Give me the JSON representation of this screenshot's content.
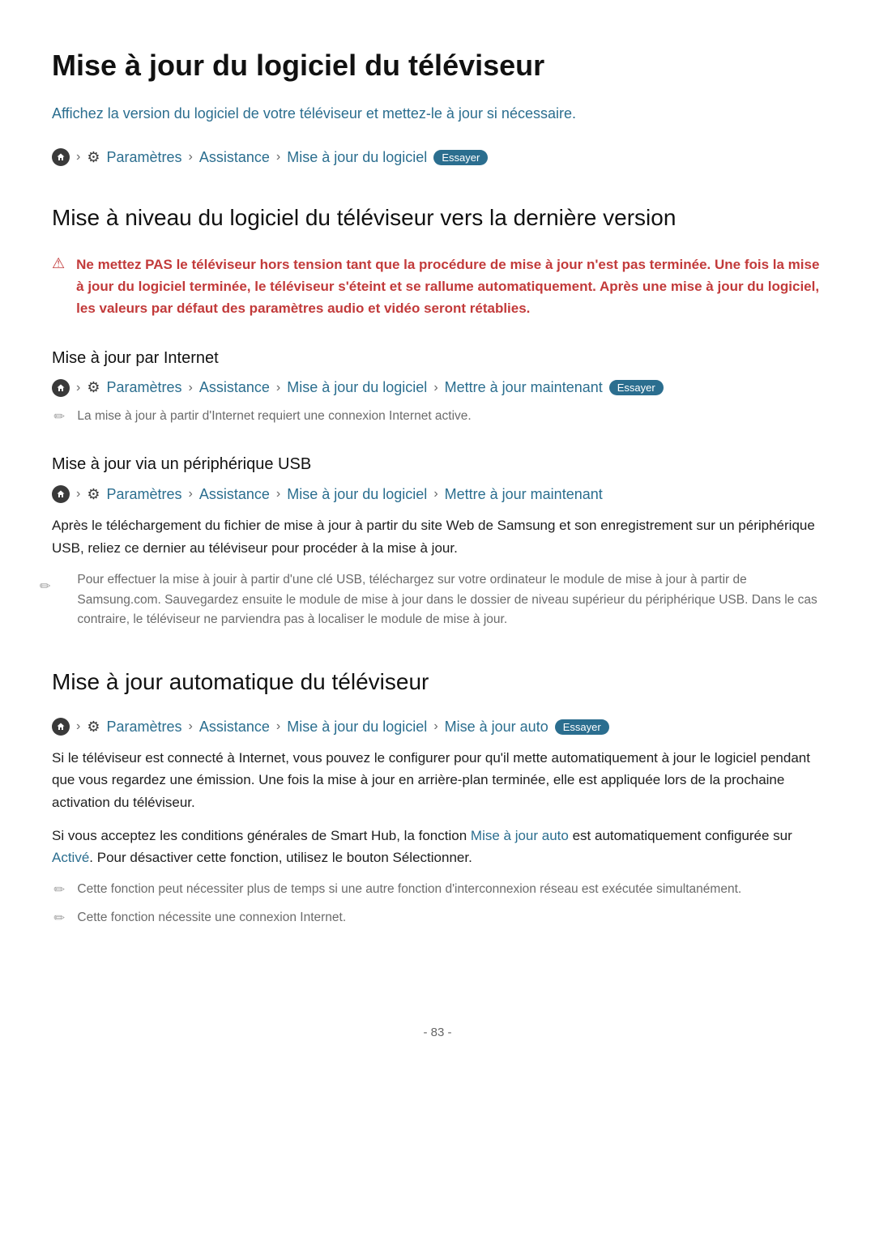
{
  "title": "Mise à jour du logiciel du téléviseur",
  "intro": "Affichez la version du logiciel de votre téléviseur et mettez-le à jour si nécessaire.",
  "bc1": {
    "parametres": "Paramètres",
    "assistance": "Assistance",
    "maj_logiciel": "Mise à jour du logiciel",
    "try": "Essayer"
  },
  "h2_upgrade": "Mise à niveau du logiciel du téléviseur vers la dernière version",
  "warning": "Ne mettez PAS le téléviseur hors tension tant que la procédure de mise à jour n'est pas terminée. Une fois la mise à jour du logiciel terminée, le téléviseur s'éteint et se rallume automatiquement. Après une mise à jour du logiciel, les valeurs par défaut des paramètres audio et vidéo seront rétablies.",
  "h3_internet": "Mise à jour par Internet",
  "bc2": {
    "parametres": "Paramètres",
    "assistance": "Assistance",
    "maj_logiciel": "Mise à jour du logiciel",
    "mettre_a_jour": "Mettre à jour maintenant",
    "try": "Essayer"
  },
  "note_internet": "La mise à jour à partir d'Internet requiert une connexion Internet active.",
  "h3_usb": "Mise à jour via un périphérique USB",
  "bc3": {
    "parametres": "Paramètres",
    "assistance": "Assistance",
    "maj_logiciel": "Mise à jour du logiciel",
    "mettre_a_jour": "Mettre à jour maintenant"
  },
  "usb_body": "Après le téléchargement du fichier de mise à jour à partir du site Web de Samsung et son enregistrement sur un périphérique USB, reliez ce dernier au téléviseur pour procéder à la mise à jour.",
  "note_usb": "Pour effectuer la mise à jouir à partir d'une clé USB, téléchargez sur votre ordinateur le module de mise à jour à partir de Samsung.com. Sauvegardez ensuite le module de mise à jour dans le dossier de niveau supérieur du périphérique USB. Dans le cas contraire, le téléviseur ne parviendra pas à localiser le module de mise à jour.",
  "h2_auto": "Mise à jour automatique du téléviseur",
  "bc4": {
    "parametres": "Paramètres",
    "assistance": "Assistance",
    "maj_logiciel": "Mise à jour du logiciel",
    "maj_auto": "Mise à jour auto",
    "try": "Essayer"
  },
  "auto_p1": "Si le téléviseur est connecté à Internet, vous pouvez le configurer pour qu'il mette automatiquement à jour le logiciel pendant que vous regardez une émission. Une fois la mise à jour en arrière-plan terminée, elle est appliquée lors de la prochaine activation du téléviseur.",
  "auto_p2_a": "Si vous acceptez les conditions générales de Smart Hub, la fonction ",
  "auto_p2_link1": "Mise à jour auto",
  "auto_p2_b": " est automatiquement configurée sur ",
  "auto_p2_link2": "Activé",
  "auto_p2_c": ". Pour désactiver cette fonction, utilisez le bouton Sélectionner.",
  "note_auto1": "Cette fonction peut nécessiter plus de temps si une autre fonction d'interconnexion réseau est exécutée simultanément.",
  "note_auto2": "Cette fonction nécessite une connexion Internet.",
  "page_number": "- 83 -"
}
